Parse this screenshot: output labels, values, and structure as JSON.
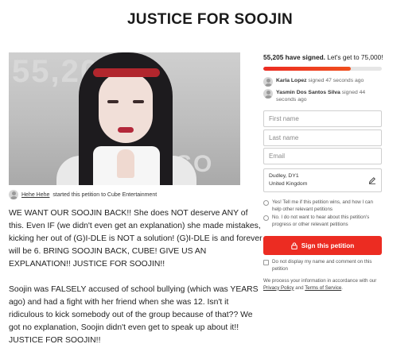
{
  "page": {
    "title": "JUSTICE FOR SOOJIN"
  },
  "hero": {
    "background_text_1": "55,205",
    "background_text_2": "SO"
  },
  "starter": {
    "name": "Hehe Hehe",
    "action": "started this petition to Cube Entertainment"
  },
  "story": {
    "paragraphs": [
      "WE WANT OUR SOOJIN BACK!! She does NOT deserve ANY of this. Even IF (we didn't even get an explanation) she made mistakes, kicking her out of (G)I-DLE is NOT a solution! (G)I-DLE is and forever will be 6. BRING SOOJIN BACK, CUBE! GIVE US AN EXPLANATION!! JUSTICE FOR SOOJIN!!",
      "Soojin was FALSELY accused of school bullying (which was YEARS ago) and had a fight with her friend when she was 12. Isn't it ridiculous to kick somebody out of the group because of that?? We got no explanation, Soojin didn't even get to speak up about it!! JUSTICE FOR SOOJIN!!"
    ]
  },
  "signatures": {
    "count_text": "55,205 have signed.",
    "goal_text": "Let's get to 75,000!",
    "progress": 0.736,
    "recent": [
      {
        "name": "Karla Lopez",
        "when": "signed 47 seconds ago"
      },
      {
        "name": "Yasmin Dos Santos Silva",
        "when": "signed 44 seconds ago"
      }
    ]
  },
  "form": {
    "first_name_placeholder": "First name",
    "last_name_placeholder": "Last name",
    "email_placeholder": "Email",
    "location_line1": "Dudley, DY1",
    "location_line2": "United Kingdom",
    "opt_in_yes": "Yes! Tell me if this petition wins, and how I can help other relevant petitions",
    "opt_in_no": "No. I do not want to hear about this petition's progress or other relevant petitions",
    "sign_button": "Sign this petition",
    "hide_name": "Do not display my name and comment on this petition",
    "privacy_prefix": "We process your information in accordance with our",
    "privacy_link": "Privacy Policy",
    "privacy_and": "and",
    "terms_link": "Terms of Service",
    "privacy_suffix": "."
  },
  "colors": {
    "accent": "#ec2c22",
    "progress_track": "#e6e6e6"
  },
  "icons": {
    "avatar": "user-avatar-icon",
    "edit": "pencil-edit-icon",
    "lock": "lock-icon"
  }
}
